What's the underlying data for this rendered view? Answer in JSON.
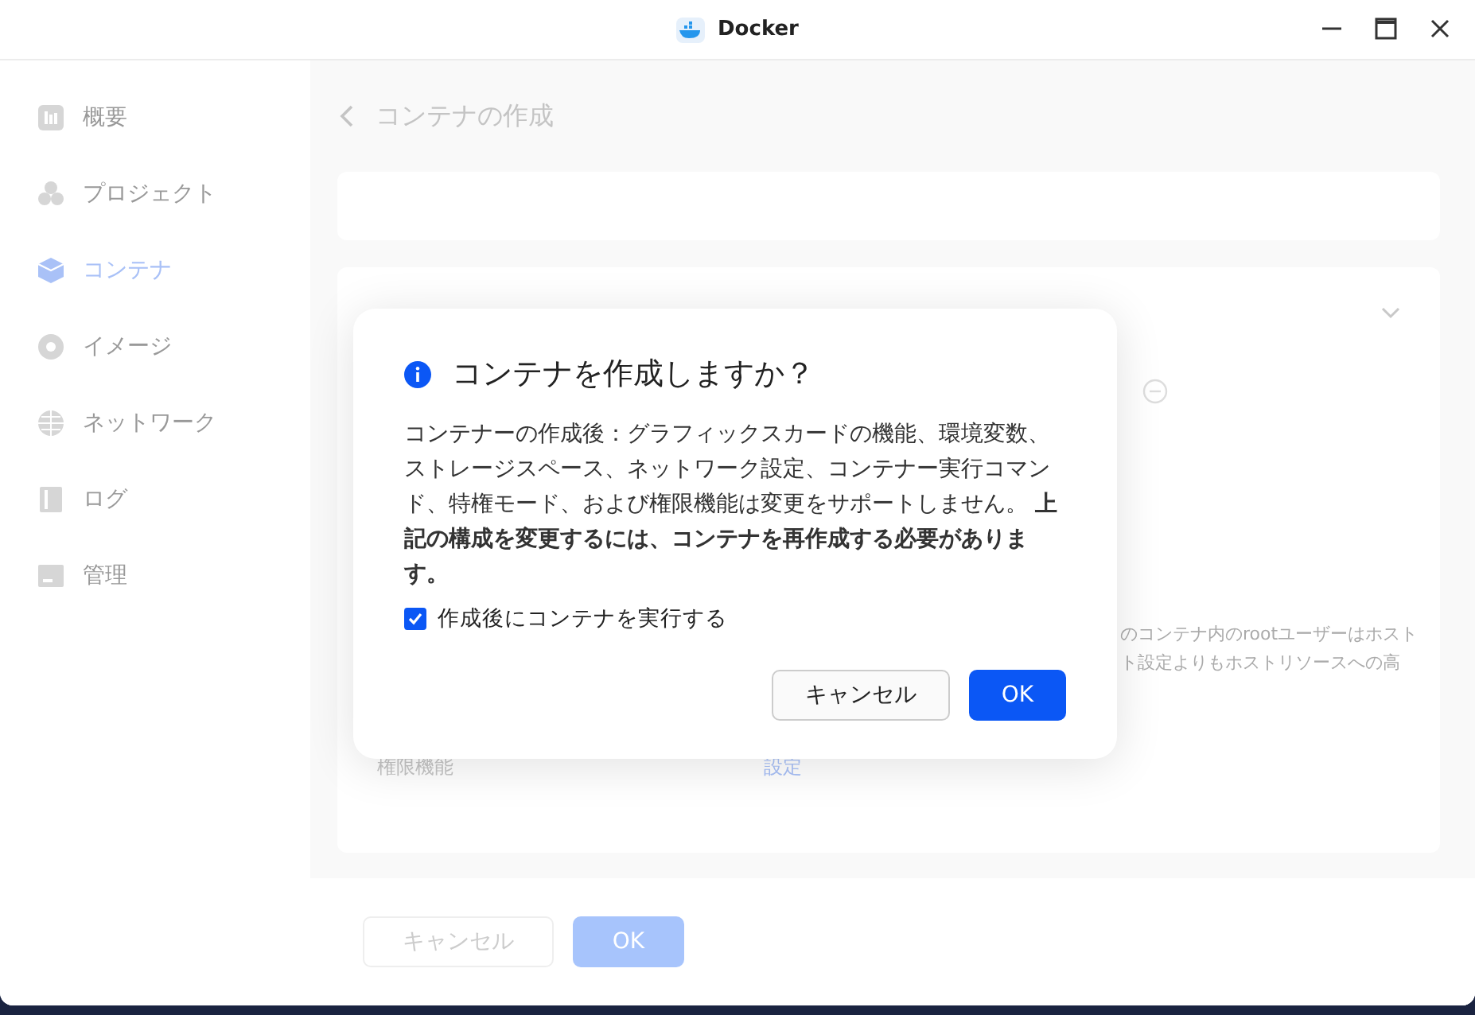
{
  "window": {
    "title": "Docker"
  },
  "sidebar": {
    "items": [
      {
        "label": "概要",
        "selected": false
      },
      {
        "label": "プロジェクト",
        "selected": false
      },
      {
        "label": "コンテナ",
        "selected": true
      },
      {
        "label": "イメージ",
        "selected": false
      },
      {
        "label": "ネットワーク",
        "selected": false
      },
      {
        "label": "ログ",
        "selected": false
      },
      {
        "label": "管理",
        "selected": false
      }
    ]
  },
  "page": {
    "title": "コンテナの作成",
    "notes": [
      "のコンテナ内のrootユーザーはホスト",
      "ト設定よりもホストリソースへの高"
    ],
    "setting": {
      "label": "権限機能",
      "link": "設定"
    },
    "buttons": [
      {
        "label": "キャンセル",
        "kind": "secondary"
      },
      {
        "label": "OK",
        "kind": "primary"
      }
    ]
  },
  "dialog": {
    "title": "コンテナを作成しますか？",
    "message": "コンテナーの作成後：グラフィックスカードの機能、環境変数、ストレージスペース、ネットワーク設定、コンテナー実行コマンド、特権モード、および権限機能は変更をサポートしません。 **上記の構成を変更するには、コンテナを再作成する必要があります。**",
    "checkbox": {
      "label": "作成後にコンテナを実行する",
      "checked": true
    },
    "buttons": [
      {
        "label": "キャンセル",
        "kind": "secondary"
      },
      {
        "label": "OK",
        "kind": "primary"
      }
    ]
  }
}
